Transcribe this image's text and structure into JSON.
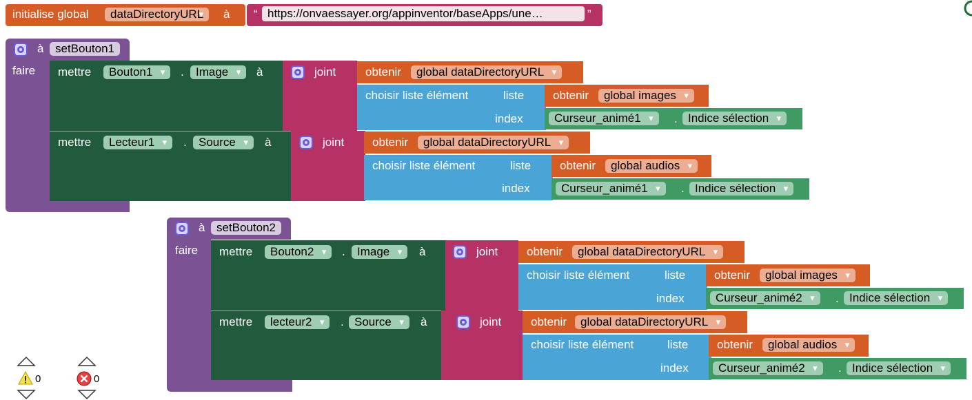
{
  "init_block": {
    "keyword": "initialise global",
    "var_name": "dataDirectoryURL",
    "to": "à",
    "quote_open": "“",
    "url": "https://onvaessayer.org/appinventor/baseApps/une…",
    "quote_close": "”"
  },
  "procedures": [
    {
      "to": "à",
      "name": "setBouton1",
      "do": "faire",
      "statements": [
        {
          "set": "mettre",
          "component": "Bouton1",
          "dot": ".",
          "property": "Image",
          "to": "à",
          "join": "joint",
          "get1": "obtenir",
          "var1": "global dataDirectoryURL",
          "select": "choisir liste élément",
          "list_label": "liste",
          "get2": "obtenir",
          "var2": "global images",
          "index_label": "index",
          "slider": "Curseur_animé1",
          "dot2": ".",
          "slider_prop": "Indice sélection"
        },
        {
          "set": "mettre",
          "component": "Lecteur1",
          "dot": ".",
          "property": "Source",
          "to": "à",
          "join": "joint",
          "get1": "obtenir",
          "var1": "global dataDirectoryURL",
          "select": "choisir liste élément",
          "list_label": "liste",
          "get2": "obtenir",
          "var2": "global audios",
          "index_label": "index",
          "slider": "Curseur_animé1",
          "dot2": ".",
          "slider_prop": "Indice sélection"
        }
      ]
    },
    {
      "to": "à",
      "name": "setBouton2",
      "do": "faire",
      "statements": [
        {
          "set": "mettre",
          "component": "Bouton2",
          "dot": ".",
          "property": "Image",
          "to": "à",
          "join": "joint",
          "get1": "obtenir",
          "var1": "global dataDirectoryURL",
          "select": "choisir liste élément",
          "list_label": "liste",
          "get2": "obtenir",
          "var2": "global images",
          "index_label": "index",
          "slider": "Curseur_animé2",
          "dot2": ".",
          "slider_prop": "Indice sélection"
        },
        {
          "set": "mettre",
          "component": "lecteur2",
          "dot": ".",
          "property": "Source",
          "to": "à",
          "join": "joint",
          "get1": "obtenir",
          "var1": "global dataDirectoryURL",
          "select": "choisir liste élément",
          "list_label": "liste",
          "get2": "obtenir",
          "var2": "global audios",
          "index_label": "index",
          "slider": "Curseur_animé2",
          "dot2": ".",
          "slider_prop": "Indice sélection"
        }
      ]
    }
  ],
  "indicators": {
    "warnings": {
      "icon": "warning-icon",
      "count": "0"
    },
    "errors": {
      "icon": "error-icon",
      "count": "0"
    }
  },
  "colors": {
    "variable": "#d65c25",
    "text": "#b73264",
    "procedure": "#7b5294",
    "component_set": "#215a3c",
    "list": "#4aa5d6",
    "component_get": "#3f9a63"
  }
}
